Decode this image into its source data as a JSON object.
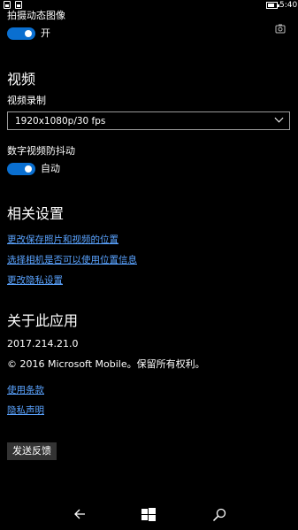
{
  "status_bar": {
    "time": "5:40"
  },
  "camera_settings": {
    "live_images_label": "拍摄动态图像",
    "live_images_state": "开"
  },
  "video": {
    "header": "视频",
    "recording_label": "视频录制",
    "recording_value": "1920x1080p/30 fps",
    "stabilization_label": "数字视频防抖动",
    "stabilization_state": "自动"
  },
  "related": {
    "header": "相关设置",
    "links": [
      "更改保存照片和视频的位置",
      "选择相机是否可以使用位置信息",
      "更改隐私设置"
    ]
  },
  "about": {
    "header": "关于此应用",
    "version": "2017.214.21.0",
    "copyright": "© 2016 Microsoft Mobile。保留所有权利。",
    "links": [
      "使用条款",
      "隐私声明"
    ],
    "feedback_button": "发送反馈"
  },
  "colors": {
    "accent": "#0a6fd0",
    "link": "#5aa3ff",
    "background": "#000000"
  },
  "icons": {
    "settings_glyph": "camera-settings-icon",
    "nav_back": "back-arrow-icon",
    "nav_start": "windows-start-icon",
    "nav_search": "search-icon"
  }
}
